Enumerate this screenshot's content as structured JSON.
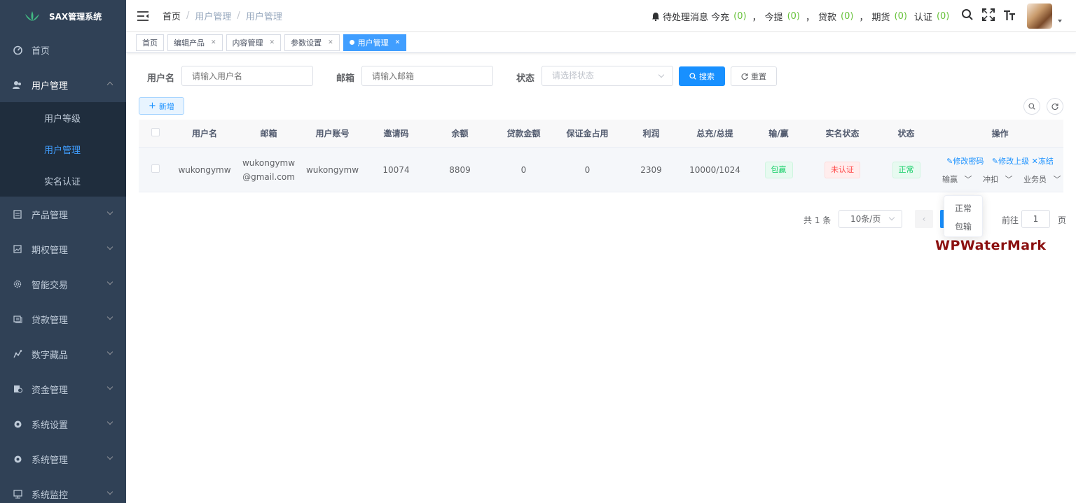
{
  "app": {
    "title": "SAX管理系统"
  },
  "sidebar": {
    "items": [
      {
        "label": "首页",
        "icon": "dashboard-icon"
      },
      {
        "label": "用户管理",
        "icon": "user-icon"
      },
      {
        "label": "产品管理",
        "icon": "document-icon"
      },
      {
        "label": "期权管理",
        "icon": "chart-icon"
      },
      {
        "label": "智能交易",
        "icon": "gear-icon"
      },
      {
        "label": "贷款管理",
        "icon": "money-icon"
      },
      {
        "label": "数字藏品",
        "icon": "guide-icon"
      },
      {
        "label": "资金管理",
        "icon": "money-bag-icon"
      },
      {
        "label": "系统设置",
        "icon": "system-icon"
      },
      {
        "label": "系统管理",
        "icon": "system-icon"
      },
      {
        "label": "系统监控",
        "icon": "monitor-icon"
      }
    ],
    "sub_items": [
      {
        "label": "用户等级"
      },
      {
        "label": "用户管理"
      },
      {
        "label": "实名认证"
      }
    ]
  },
  "navbar": {
    "breadcrumb": [
      "首页",
      "用户管理",
      "用户管理"
    ],
    "notice": {
      "prefix": "待处理消息 今充",
      "recharge": "(0)",
      "withdraw_label": "今提",
      "withdraw": "(0)",
      "loan_label": "贷款",
      "loan": "(0)",
      "futures_label": "期货",
      "futures": "(0)",
      "verify_label": "认证",
      "verify": "(0)",
      "sep": "，"
    }
  },
  "tags": [
    {
      "label": "首页"
    },
    {
      "label": "编辑产品"
    },
    {
      "label": "内容管理"
    },
    {
      "label": "参数设置"
    },
    {
      "label": "用户管理"
    }
  ],
  "filter": {
    "username_label": "用户名",
    "username_placeholder": "请输入用户名",
    "email_label": "邮箱",
    "email_placeholder": "请输入邮箱",
    "status_label": "状态",
    "status_placeholder": "请选择状态",
    "search_label": "搜索",
    "reset_label": "重置"
  },
  "toolbar": {
    "add_label": "新增"
  },
  "table": {
    "columns": [
      "用户名",
      "邮箱",
      "用户账号",
      "邀请码",
      "余额",
      "贷款金额",
      "保证金占用",
      "利润",
      "总充/总提",
      "输/赢",
      "实名状态",
      "状态",
      "操作"
    ],
    "rows": [
      {
        "username": "wukongymw",
        "email_line1": "wukongymw",
        "email_line2": "@gmail.com",
        "account": "wukongymw",
        "invite": "10074",
        "balance": "8809",
        "loan": "0",
        "margin": "0",
        "profit": "2309",
        "total": "10000/1024",
        "win_lose": "包赢",
        "verify_status": "未认证",
        "status": "正常",
        "op_change_pwd": "修改密码",
        "op_change_parent": "修改上级",
        "op_freeze": "冻结",
        "op_win_lose": "输赢",
        "op_adjust": "冲扣",
        "op_staff": "业务员"
      }
    ]
  },
  "pagination": {
    "total": "共 1 条",
    "page_size": "10条/页",
    "goto_label": "前往",
    "page_value": "1",
    "page_unit": "页"
  },
  "dropdown": {
    "options": [
      "正常",
      "包输"
    ]
  },
  "watermark": "WPWaterMark"
}
